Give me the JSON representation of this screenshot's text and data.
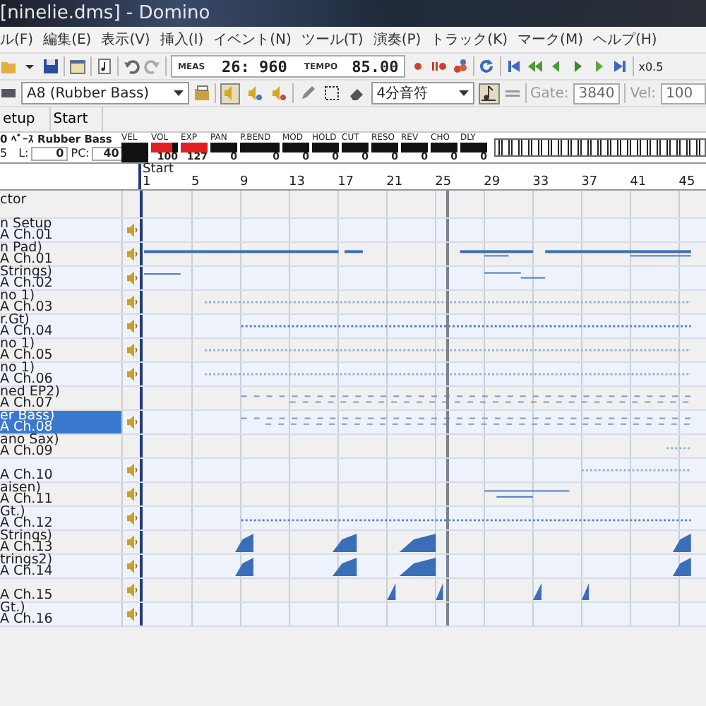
{
  "window": {
    "title": "[ninelie.dms] - Domino"
  },
  "menu": [
    "ル(F)",
    "編集(E)",
    "表示(V)",
    "挿入(I)",
    "イベント(N)",
    "ツール(T)",
    "演奏(P)",
    "トラック(K)",
    "マーク(M)",
    "ヘルプ(H)"
  ],
  "toolbar": {
    "meas_label": "MEAS",
    "meas": "26: 960",
    "tempo_label": "TEMPO",
    "tempo": "85.00",
    "speed": "x0.5"
  },
  "track_toolbar": {
    "instrument": "A8 (Rubber Bass)",
    "note_length": "4分音符",
    "gate_label": "Gate:",
    "gate": "3840",
    "vel_label": "Vel:",
    "vel": "100"
  },
  "tools": [
    {
      "kind": "speaker",
      "pressed": true
    },
    {
      "kind": "solo",
      "pressed": false
    },
    {
      "kind": "all",
      "pressed": false
    },
    {
      "kind": "pencil",
      "pressed": false
    },
    {
      "kind": "select",
      "pressed": false
    },
    {
      "kind": "eraser",
      "pressed": false
    }
  ],
  "note_toggle": {
    "pressed": true
  },
  "tabs": [
    {
      "label": "etup",
      "selected": false
    },
    {
      "label": "Start",
      "selected": false
    }
  ],
  "track_info": {
    "name": "0 ﾍﾞｰｽ Rubber Bass",
    "number": "5",
    "l_label": "L:",
    "l": "0",
    "pc_label": "PC:",
    "pc": "40"
  },
  "meters": [
    {
      "label": "VEL"
    },
    {
      "label": "VOL",
      "level": 0.79,
      "value": "100"
    },
    {
      "label": "EXP",
      "level": 1,
      "value": "127"
    },
    {
      "label": "PAN",
      "value": "0"
    },
    {
      "label": "P.BEND",
      "value": "0"
    },
    {
      "label": "MOD",
      "value": "0"
    },
    {
      "label": "HOLD",
      "value": "0"
    },
    {
      "label": "CUT",
      "value": "0"
    },
    {
      "label": "RESO",
      "value": "0"
    },
    {
      "label": "REV",
      "value": "0"
    },
    {
      "label": "CHO",
      "value": "0"
    },
    {
      "label": "DLY",
      "value": "0"
    }
  ],
  "ruler": {
    "marker": "Start",
    "measures": [
      "1",
      "5",
      "9",
      "13",
      "17",
      "21",
      "25",
      "29",
      "33",
      "37",
      "41",
      "45"
    ]
  },
  "conductor": {
    "name": "ctor"
  },
  "tracks": [
    {
      "name": "n Setup",
      "channel": "A  Ch.01",
      "speaker": true,
      "selected": false
    },
    {
      "name": "n Pad)",
      "channel": "A  Ch.01",
      "speaker": true,
      "selected": false
    },
    {
      "name": "Strings)",
      "channel": "A  Ch.02",
      "speaker": true,
      "selected": false
    },
    {
      "name": "no 1)",
      "channel": "A  Ch.03",
      "speaker": true,
      "selected": false
    },
    {
      "name": "r.Gt)",
      "channel": "A  Ch.04",
      "speaker": true,
      "selected": false
    },
    {
      "name": "no 1)",
      "channel": "A  Ch.05",
      "speaker": true,
      "selected": false
    },
    {
      "name": "no 1)",
      "channel": "A  Ch.06",
      "speaker": true,
      "selected": false
    },
    {
      "name": "ned EP2)",
      "channel": "A  Ch.07",
      "speaker": false,
      "selected": false
    },
    {
      "name": "er Bass)",
      "channel": "A  Ch.08",
      "speaker": true,
      "selected": true
    },
    {
      "name": "ano Sax)",
      "channel": "A  Ch.09",
      "speaker": false,
      "selected": false
    },
    {
      "channel": "A  Ch.10",
      "speaker": true,
      "selected": false
    },
    {
      "name": "aisen)",
      "channel": "A  Ch.11",
      "speaker": true,
      "selected": false
    },
    {
      "name": "Gt.)",
      "channel": "A  Ch.12",
      "speaker": true,
      "selected": false
    },
    {
      "name": "Strings)",
      "channel": "A  Ch.13",
      "speaker": true,
      "selected": false
    },
    {
      "name": "trings2)",
      "channel": "A  Ch.14",
      "speaker": true,
      "selected": false
    },
    {
      "channel": "A  Ch.15",
      "speaker": true,
      "selected": false
    },
    {
      "name": "Gt.)",
      "channel": "A  Ch.16",
      "speaker": true,
      "selected": false
    }
  ]
}
